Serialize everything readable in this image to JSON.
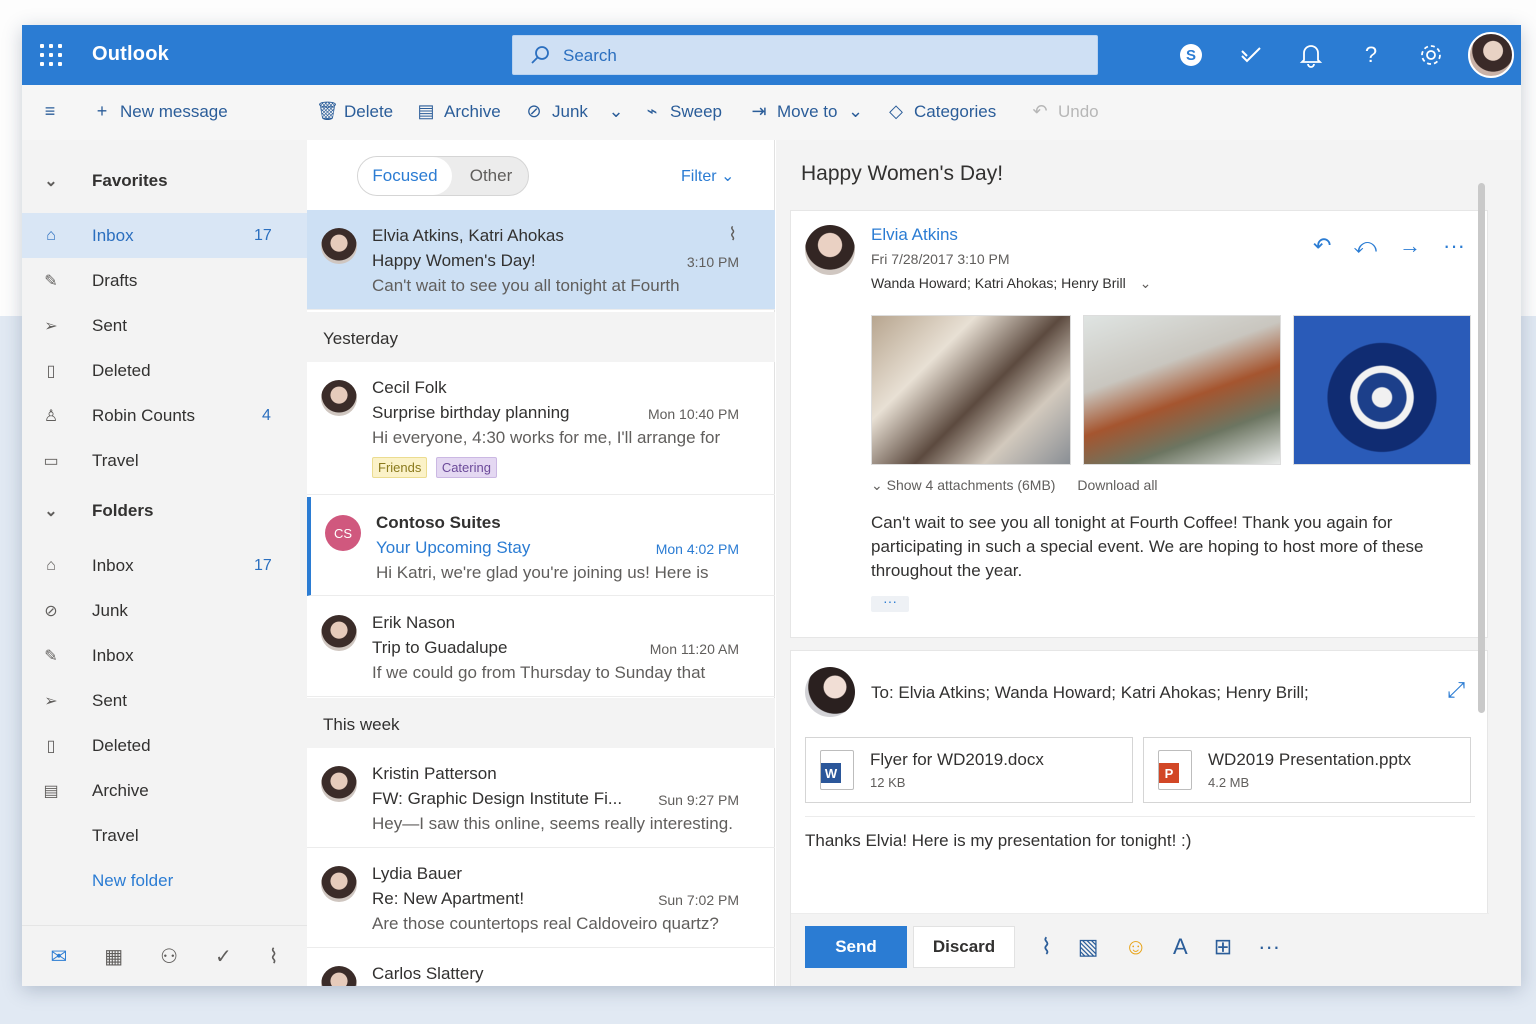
{
  "app": {
    "name": "Outlook"
  },
  "search": {
    "placeholder": "Search"
  },
  "header_icons": [
    "skype-icon",
    "todo-icon",
    "bell-icon",
    "help-icon",
    "gear-icon",
    "user-avatar"
  ],
  "commands": {
    "new_message": "New message",
    "delete": "Delete",
    "archive": "Archive",
    "junk": "Junk",
    "sweep": "Sweep",
    "move_to": "Move to",
    "categories": "Categories",
    "undo": "Undo"
  },
  "nav": {
    "favorites": {
      "heading": "Favorites",
      "items": [
        {
          "label": "Inbox",
          "count": "17",
          "icon": "inbox-icon"
        },
        {
          "label": "Drafts",
          "count": "",
          "icon": "pencil-icon"
        },
        {
          "label": "Sent",
          "count": "",
          "icon": "send-icon"
        },
        {
          "label": "Deleted",
          "count": "",
          "icon": "trash-icon"
        },
        {
          "label": "Robin Counts",
          "count": "4",
          "icon": "person-icon"
        },
        {
          "label": "Travel",
          "count": "",
          "icon": "folder-icon"
        }
      ]
    },
    "folders": {
      "heading": "Folders",
      "items": [
        {
          "label": "Inbox",
          "count": "17",
          "icon": "inbox-icon"
        },
        {
          "label": "Junk",
          "count": "",
          "icon": "junk-icon"
        },
        {
          "label": "Inbox",
          "count": "",
          "icon": "pencil-icon"
        },
        {
          "label": "Sent",
          "count": "",
          "icon": "send-icon"
        },
        {
          "label": "Deleted",
          "count": "",
          "icon": "trash-icon"
        },
        {
          "label": "Archive",
          "count": "",
          "icon": "archive-icon"
        },
        {
          "label": "Travel",
          "count": "",
          "icon": ""
        }
      ]
    },
    "new_folder": "New folder"
  },
  "list": {
    "tabs": {
      "focused": "Focused",
      "other": "Other"
    },
    "filter": "Filter",
    "groups": {
      "yesterday": "Yesterday",
      "this_week": "This week"
    },
    "messages": [
      {
        "from": "Elvia Atkins, Katri Ahokas",
        "subject": "Happy Women's Day!",
        "time": "3:10 PM",
        "preview": "Can't wait to see you all tonight at Fourth"
      },
      {
        "from": "Cecil Folk",
        "subject": "Surprise birthday planning",
        "time": "Mon 10:40 PM",
        "preview": "Hi everyone, 4:30 works for me, I'll arrange for",
        "tags": [
          "Friends",
          "Catering"
        ]
      },
      {
        "from": "Contoso Suites",
        "initials": "CS",
        "subject": "Your Upcoming Stay",
        "time": "Mon 4:02 PM",
        "preview": "Hi Katri, we're glad you're joining us! Here is"
      },
      {
        "from": "Erik Nason",
        "subject": "Trip to Guadalupe",
        "time": "Mon 11:20 AM",
        "preview": "If we could go from Thursday to Sunday that"
      },
      {
        "from": "Kristin Patterson",
        "subject": "FW: Graphic Design Institute Fi...",
        "time": "Sun 9:27 PM",
        "preview": "Hey—I saw this online, seems really interesting."
      },
      {
        "from": "Lydia Bauer",
        "subject": "Re: New Apartment!",
        "time": "Sun 7:02 PM",
        "preview": "Are those countertops real Caldoveiro quartz?"
      },
      {
        "from": "Carlos Slattery",
        "subject": "",
        "time": "",
        "preview": ""
      }
    ]
  },
  "reading": {
    "title": "Happy Women's Day!",
    "sender": "Elvia Atkins",
    "date": "Fri 7/28/2017 3:10 PM",
    "recipients": "Wanda Howard; Katri Ahokas; Henry Brill",
    "show_attachments": "Show 4 attachments (6MB)",
    "download_all": "Download all",
    "body": "Can't wait to see you all tonight at Fourth Coffee! Thank you again for participating in such a special event. We are hoping to host more of these throughout the year.",
    "more": "···"
  },
  "reply": {
    "to": "To: Elvia Atkins; Wanda Howard; Katri Ahokas; Henry Brill;",
    "files": [
      {
        "name": "Flyer for WD2019.docx",
        "size": "12 KB",
        "badge": "W"
      },
      {
        "name": "WD2019 Presentation.pptx",
        "size": "4.2 MB",
        "badge": "P"
      }
    ],
    "text": "Thanks Elvia! Here is my presentation for tonight! :)",
    "send": "Send",
    "discard": "Discard"
  },
  "colors": {
    "accent": "#2b7cd3",
    "nav_bg": "#f3f3f3",
    "selected": "#cde0f4"
  }
}
